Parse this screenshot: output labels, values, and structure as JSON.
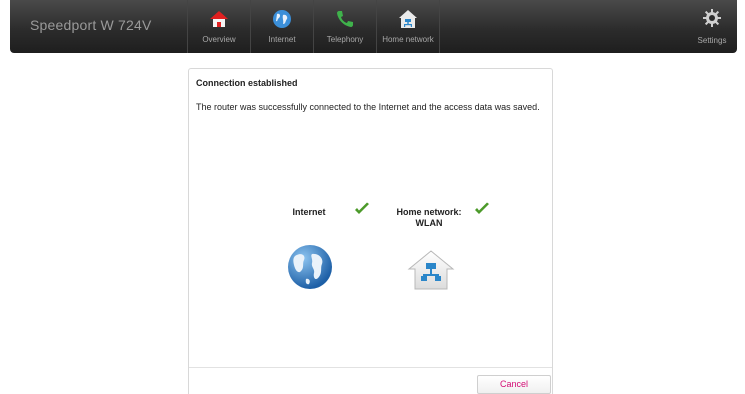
{
  "header": {
    "brand": "Speedport W 724V",
    "nav": [
      {
        "label": "Overview",
        "icon": "home-icon"
      },
      {
        "label": "Internet",
        "icon": "globe-icon"
      },
      {
        "label": "Telephony",
        "icon": "phone-icon"
      },
      {
        "label": "Home network",
        "icon": "home-network-icon"
      }
    ],
    "settings": {
      "label": "Settings",
      "icon": "gear-icon"
    }
  },
  "dialog": {
    "title": "Connection established",
    "message": "The router was successfully connected to the Internet and the access data was saved.",
    "status": [
      {
        "label": "Internet",
        "state": "ok",
        "icon": "globe-icon"
      },
      {
        "label": "Home network: WLAN",
        "label_line1": "Home network:",
        "label_line2": "WLAN",
        "state": "ok",
        "icon": "home-network-icon"
      }
    ],
    "cancel_label": "Cancel"
  },
  "colors": {
    "accent": "#d40c75",
    "check": "#4c9a2a",
    "topbar": "#2c2c2c"
  }
}
